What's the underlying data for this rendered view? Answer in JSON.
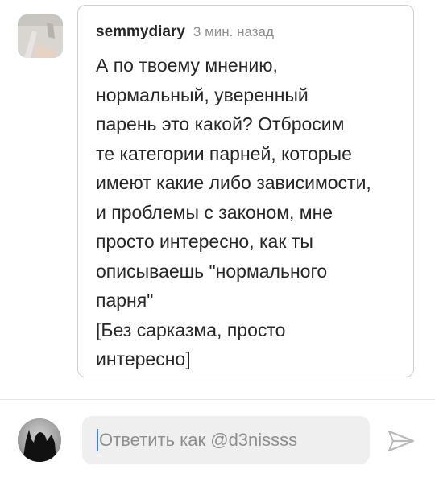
{
  "comment": {
    "username": "semmydiary",
    "time": "3 мин. назад",
    "lines": [
      "А по твоему мнению,",
      "нормальный, уверенный",
      "парень это какой? Отбросим",
      "те категории парней, которые",
      "имеют какие либо зависимости,",
      "и проблемы с законом, мне",
      "просто интересно, как ты",
      "описываешь \"нормального",
      "парня\"",
      "[Без сарказма, просто",
      "интересно]"
    ]
  },
  "reply": {
    "placeholder": "Ответить как @d3nissss"
  },
  "icons": {
    "send": "send-icon"
  }
}
